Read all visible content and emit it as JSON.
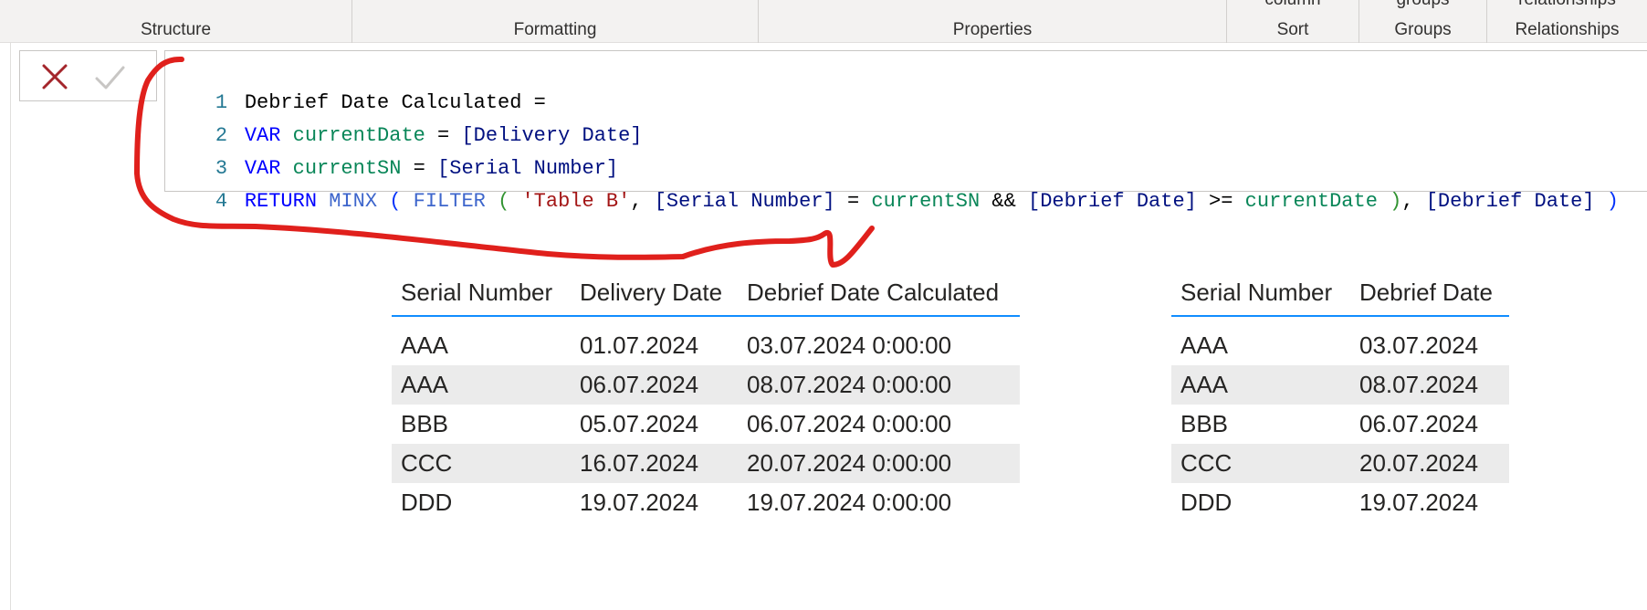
{
  "ribbon": {
    "groups": [
      {
        "label": "Structure",
        "cut": ""
      },
      {
        "label": "Formatting",
        "cut": ""
      },
      {
        "label": "Properties",
        "cut": ""
      },
      {
        "label": "Sort",
        "cut": "column"
      },
      {
        "label": "Groups",
        "cut": "groups"
      },
      {
        "label": "Relationships",
        "cut": "relationships"
      }
    ]
  },
  "formula_bar": {
    "cancel_icon": "x-icon",
    "commit_icon": "check-icon",
    "line_numbers": [
      "1",
      "2",
      "3",
      "4"
    ],
    "line1": {
      "name": "Debrief Date Calculated",
      "eq": " ="
    },
    "line2": {
      "kw": "VAR",
      "var": "currentDate",
      "eq": " = ",
      "col": "[Delivery Date]"
    },
    "line3": {
      "kw": "VAR",
      "var": "currentSN",
      "eq": " = ",
      "col": "[Serial Number]"
    },
    "line4": {
      "kw": "RETURN",
      "fn1": "MINX",
      "open1": "(",
      "fn2": "FILTER",
      "open2": "(",
      "table": "'Table B'",
      "comma1": ",",
      "col1": "[Serial Number]",
      "eq": " = ",
      "var1": "currentSN",
      "and": " && ",
      "col2": "[Debrief Date]",
      "gte": " >= ",
      "var2": "currentDate",
      "close2": ")",
      "comma2": ",",
      "col3": "[Debrief Date]",
      "close1": ")"
    }
  },
  "table_a": {
    "headers": [
      "Serial Number",
      "Delivery Date",
      "Debrief Date Calculated"
    ],
    "rows": [
      [
        "AAA",
        "01.07.2024",
        "03.07.2024 0:00:00"
      ],
      [
        "AAA",
        "06.07.2024",
        "08.07.2024 0:00:00"
      ],
      [
        "BBB",
        "05.07.2024",
        "06.07.2024 0:00:00"
      ],
      [
        "CCC",
        "16.07.2024",
        "20.07.2024 0:00:00"
      ],
      [
        "DDD",
        "19.07.2024",
        "19.07.2024 0:00:00"
      ]
    ]
  },
  "table_b": {
    "headers": [
      "Serial Number",
      "Debrief Date"
    ],
    "rows": [
      [
        "AAA",
        "03.07.2024"
      ],
      [
        "AAA",
        "08.07.2024"
      ],
      [
        "BBB",
        "06.07.2024"
      ],
      [
        "CCC",
        "20.07.2024"
      ],
      [
        "DDD",
        "19.07.2024"
      ]
    ]
  },
  "colors": {
    "header_underline": "#118dff",
    "alt_row": "#ebebeb",
    "annotation": "#e0201c"
  }
}
